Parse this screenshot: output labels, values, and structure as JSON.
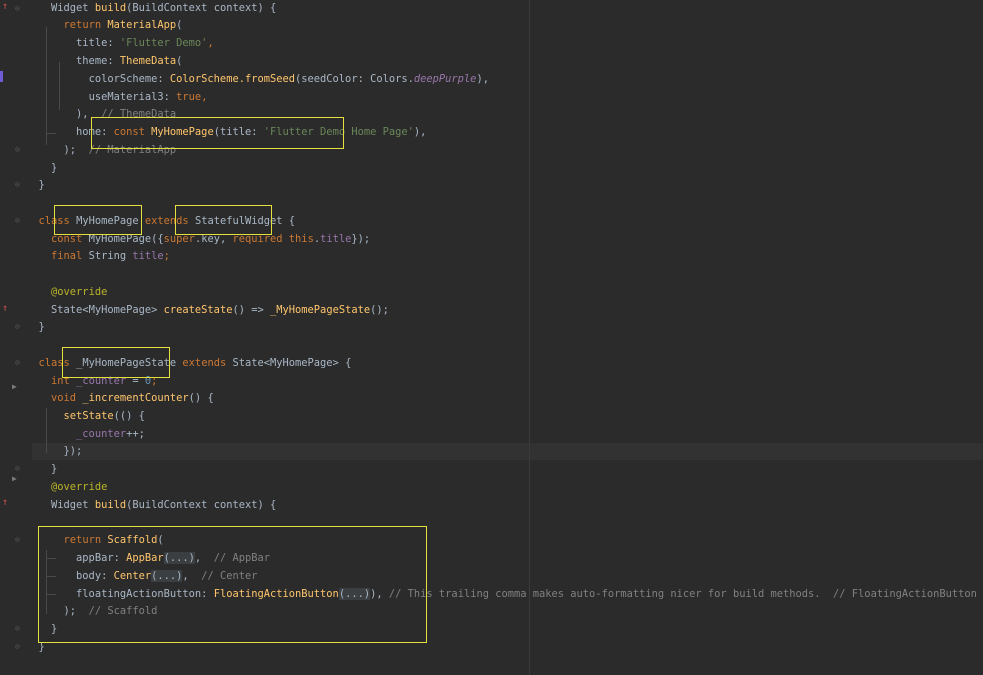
{
  "editor": {
    "lines": [
      [
        [
          "    ",
          ""
        ],
        [
          "Widget ",
          ""
        ],
        [
          "build",
          "fn"
        ],
        [
          "(BuildContext context) {",
          ""
        ]
      ],
      [
        [
          "      ",
          ""
        ],
        [
          "return ",
          "kw"
        ],
        [
          "MaterialApp",
          "fn"
        ],
        [
          "(",
          ""
        ]
      ],
      [
        [
          "        ",
          ""
        ],
        [
          "title: ",
          ""
        ],
        [
          "'Flutter Demo'",
          "str"
        ],
        [
          ",",
          "kw"
        ]
      ],
      [
        [
          "        ",
          ""
        ],
        [
          "theme: ",
          ""
        ],
        [
          "ThemeData",
          "fn"
        ],
        [
          "(",
          ""
        ]
      ],
      [
        [
          "          ",
          ""
        ],
        [
          "colorScheme: ",
          ""
        ],
        [
          "ColorScheme.",
          "fn"
        ],
        [
          "fromSeed",
          "fn"
        ],
        [
          "(seedColor: Colors.",
          ""
        ],
        [
          "deepPurple",
          "fld-i"
        ],
        [
          "),",
          ""
        ]
      ],
      [
        [
          "          ",
          ""
        ],
        [
          "useMaterial3: ",
          ""
        ],
        [
          "true",
          "kw"
        ],
        [
          ",",
          "kw"
        ]
      ],
      [
        [
          "        ",
          ""
        ],
        [
          "),  ",
          ""
        ],
        [
          "// ThemeData",
          "cmt"
        ]
      ],
      [
        [
          "        ",
          ""
        ],
        [
          "home: ",
          ""
        ],
        [
          "const ",
          "kw"
        ],
        [
          "MyHomePage",
          "fn"
        ],
        [
          "(title: ",
          ""
        ],
        [
          "'Flutter Demo Home Page'",
          "str"
        ],
        [
          "),",
          ""
        ]
      ],
      [
        [
          "      ",
          ""
        ],
        [
          ");  ",
          ""
        ],
        [
          "// MaterialApp",
          "cmt"
        ]
      ],
      [
        [
          "    ",
          ""
        ],
        [
          "}",
          ""
        ]
      ],
      [
        [
          "  ",
          ""
        ],
        [
          "}",
          ""
        ]
      ],
      [
        [
          "",
          ""
        ]
      ],
      [
        [
          "  ",
          ""
        ],
        [
          "class ",
          "kw"
        ],
        [
          "MyHomePage ",
          ""
        ],
        [
          "extends ",
          "kw"
        ],
        [
          "StatefulWidget ",
          ""
        ],
        [
          "{",
          ""
        ]
      ],
      [
        [
          "    ",
          ""
        ],
        [
          "const ",
          "kw"
        ],
        [
          "MyHomePage",
          ""
        ],
        [
          "({",
          ""
        ],
        [
          "super",
          "kw"
        ],
        [
          ".key, ",
          ""
        ],
        [
          "required ",
          "kw"
        ],
        [
          "this",
          "kw"
        ],
        [
          ".",
          ""
        ],
        [
          "title",
          "fld"
        ],
        [
          "});",
          ""
        ]
      ],
      [
        [
          "    ",
          ""
        ],
        [
          "final ",
          "kw"
        ],
        [
          "String ",
          ""
        ],
        [
          "title",
          "fld"
        ],
        [
          ";",
          "kw"
        ]
      ],
      [
        [
          "",
          ""
        ]
      ],
      [
        [
          "    ",
          ""
        ],
        [
          "@override",
          "ann"
        ]
      ],
      [
        [
          "    ",
          ""
        ],
        [
          "State<MyHomePage> ",
          ""
        ],
        [
          "createState",
          "fn"
        ],
        [
          "() => ",
          ""
        ],
        [
          "_MyHomePageState",
          "fn"
        ],
        [
          "();",
          ""
        ]
      ],
      [
        [
          "  ",
          ""
        ],
        [
          "}",
          ""
        ]
      ],
      [
        [
          "",
          ""
        ]
      ],
      [
        [
          "  ",
          ""
        ],
        [
          "class ",
          "kw"
        ],
        [
          "_MyHomePageState ",
          ""
        ],
        [
          "extends ",
          "kw"
        ],
        [
          "State<MyHomePage> {",
          ""
        ]
      ],
      [
        [
          "    ",
          ""
        ],
        [
          "int ",
          "kw"
        ],
        [
          "_counter ",
          "fld"
        ],
        [
          "= ",
          ""
        ],
        [
          "0",
          "num"
        ],
        [
          ";",
          "kw"
        ]
      ],
      [
        [
          "    ",
          ""
        ],
        [
          "void ",
          "kw"
        ],
        [
          "_incrementCounter",
          "fn"
        ],
        [
          "() {",
          ""
        ]
      ],
      [
        [
          "      ",
          ""
        ],
        [
          "setState",
          "fn"
        ],
        [
          "(() {",
          ""
        ]
      ],
      [
        [
          "        ",
          ""
        ],
        [
          "_counter",
          "fld"
        ],
        [
          "++;",
          ""
        ]
      ],
      [
        [
          "      ",
          ""
        ],
        [
          "});",
          ""
        ]
      ],
      [
        [
          "    ",
          ""
        ],
        [
          "}",
          ""
        ]
      ],
      [
        [
          "    ",
          ""
        ],
        [
          "@override",
          "ann"
        ]
      ],
      [
        [
          "    ",
          ""
        ],
        [
          "Widget ",
          ""
        ],
        [
          "build",
          "fn"
        ],
        [
          "(BuildContext context) {",
          ""
        ]
      ],
      [
        [
          "",
          ""
        ]
      ],
      [
        [
          "      ",
          ""
        ],
        [
          "return ",
          "kw"
        ],
        [
          "Scaffold",
          "fn"
        ],
        [
          "(",
          ""
        ]
      ],
      [
        [
          "        ",
          ""
        ],
        [
          "appBar: ",
          ""
        ],
        [
          "AppBar",
          "fn"
        ],
        [
          "(...)",
          "fold-box"
        ],
        [
          ",  ",
          ""
        ],
        [
          "// AppBar",
          "cmt"
        ]
      ],
      [
        [
          "        ",
          ""
        ],
        [
          "body: ",
          ""
        ],
        [
          "Center",
          "fn"
        ],
        [
          "(...)",
          "fold-box"
        ],
        [
          ",  ",
          ""
        ],
        [
          "// Center",
          "cmt"
        ]
      ],
      [
        [
          "        ",
          ""
        ],
        [
          "floatingActionButton: ",
          ""
        ],
        [
          "FloatingActionButton",
          "fn"
        ],
        [
          "(...)",
          "fold-box"
        ],
        [
          "), ",
          ""
        ],
        [
          "// This trailing comma makes auto-formatting nicer for build methods.  // FloatingActionButton",
          "cmt"
        ]
      ],
      [
        [
          "      ",
          ""
        ],
        [
          ");  ",
          ""
        ],
        [
          "// Scaffold",
          "cmt"
        ]
      ],
      [
        [
          "    ",
          ""
        ],
        [
          "}",
          ""
        ]
      ],
      [
        [
          "  ",
          ""
        ],
        [
          "}",
          ""
        ]
      ]
    ],
    "line_tops": [
      0,
      17,
      35,
      53,
      71,
      89,
      106,
      124,
      142,
      160,
      177,
      195,
      213,
      231,
      248,
      266,
      284,
      302,
      319,
      337,
      355,
      373,
      390,
      408,
      426,
      443,
      461,
      479,
      497,
      515,
      532,
      550,
      568,
      586,
      603,
      621,
      639
    ],
    "highlight_boxes": [
      "const-myhomepage-box",
      "myhomepage-class-box",
      "statefulwidget-box",
      "myhomepagestate-box",
      "scaffold-block-box"
    ]
  }
}
